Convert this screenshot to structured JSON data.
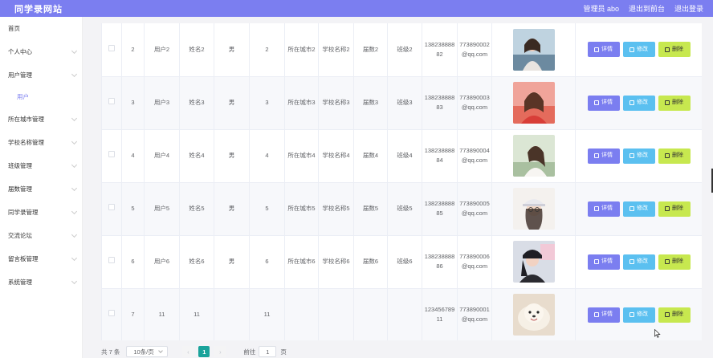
{
  "topbar": {
    "brand": "同学录网站",
    "user": "管理员 abo",
    "back_label": "退出到前台",
    "logout_label": "退出登录"
  },
  "sidebar": {
    "items": [
      {
        "label": "首页",
        "expand": false
      },
      {
        "label": "个人中心",
        "expand": true
      },
      {
        "label": "用户管理",
        "expand": true
      },
      {
        "label": "用户",
        "expand": false,
        "sub": true
      },
      {
        "label": "所在城市管理",
        "expand": true
      },
      {
        "label": "学校名称管理",
        "expand": true
      },
      {
        "label": "班级管理",
        "expand": true
      },
      {
        "label": "届数管理",
        "expand": true
      },
      {
        "label": "同学录管理",
        "expand": true
      },
      {
        "label": "交流论坛",
        "expand": true
      },
      {
        "label": "留言板管理",
        "expand": true
      },
      {
        "label": "系统管理",
        "expand": true
      }
    ]
  },
  "table": {
    "rows": [
      {
        "no": "2",
        "account": "用户2",
        "name": "姓名2",
        "gender": "男",
        "age": "2",
        "city": "所在城市2",
        "school": "学校名称2",
        "session": "届数2",
        "class": "班级2",
        "phone": "13823888882",
        "email": "773890002@qq.com"
      },
      {
        "no": "3",
        "account": "用户3",
        "name": "姓名3",
        "gender": "男",
        "age": "3",
        "city": "所在城市3",
        "school": "学校名称3",
        "session": "届数3",
        "class": "班级3",
        "phone": "13823888883",
        "email": "773890003@qq.com"
      },
      {
        "no": "4",
        "account": "用户4",
        "name": "姓名4",
        "gender": "男",
        "age": "4",
        "city": "所在城市4",
        "school": "学校名称4",
        "session": "届数4",
        "class": "班级4",
        "phone": "13823888884",
        "email": "773890004@qq.com"
      },
      {
        "no": "5",
        "account": "用户5",
        "name": "姓名5",
        "gender": "男",
        "age": "5",
        "city": "所在城市5",
        "school": "学校名称5",
        "session": "届数5",
        "class": "班级5",
        "phone": "13823888885",
        "email": "773890005@qq.com"
      },
      {
        "no": "6",
        "account": "用户6",
        "name": "姓名6",
        "gender": "男",
        "age": "6",
        "city": "所在城市6",
        "school": "学校名称6",
        "session": "届数6",
        "class": "班级6",
        "phone": "13823888886",
        "email": "773890006@qq.com"
      },
      {
        "no": "7",
        "account": "11",
        "name": "11",
        "gender": "",
        "age": "11",
        "city": "",
        "school": "",
        "session": "",
        "class": "",
        "phone": "12345678911",
        "email": "773890001@qq.com"
      }
    ],
    "actions": {
      "detail_label": "详情",
      "edit_label": "修改",
      "delete_label": "删除"
    }
  },
  "pagination": {
    "total_text": "共 7 条",
    "page_size_text": "10条/页",
    "prev_icon": "chevron-left-icon",
    "next_icon": "chevron-right-icon",
    "current_page": "1",
    "goto_label": "前往",
    "goto_value": "1",
    "page_unit": "页"
  },
  "colors": {
    "primary": "#7b7ef0",
    "edit": "#5bc0f0",
    "delete": "#c7e84f",
    "active_page": "#1aa39b"
  }
}
